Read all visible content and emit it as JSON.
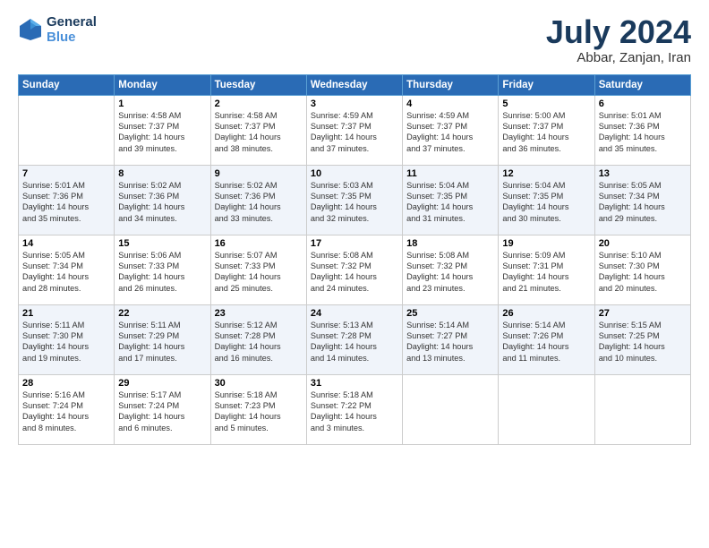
{
  "header": {
    "logo_line1": "General",
    "logo_line2": "Blue",
    "month": "July 2024",
    "location": "Abbar, Zanjan, Iran"
  },
  "weekdays": [
    "Sunday",
    "Monday",
    "Tuesday",
    "Wednesday",
    "Thursday",
    "Friday",
    "Saturday"
  ],
  "weeks": [
    [
      {
        "day": "",
        "sunrise": "",
        "sunset": "",
        "daylight": ""
      },
      {
        "day": "1",
        "sunrise": "Sunrise: 4:58 AM",
        "sunset": "Sunset: 7:37 PM",
        "daylight": "Daylight: 14 hours",
        "extra": "and 39 minutes."
      },
      {
        "day": "2",
        "sunrise": "Sunrise: 4:58 AM",
        "sunset": "Sunset: 7:37 PM",
        "daylight": "Daylight: 14 hours",
        "extra": "and 38 minutes."
      },
      {
        "day": "3",
        "sunrise": "Sunrise: 4:59 AM",
        "sunset": "Sunset: 7:37 PM",
        "daylight": "Daylight: 14 hours",
        "extra": "and 37 minutes."
      },
      {
        "day": "4",
        "sunrise": "Sunrise: 4:59 AM",
        "sunset": "Sunset: 7:37 PM",
        "daylight": "Daylight: 14 hours",
        "extra": "and 37 minutes."
      },
      {
        "day": "5",
        "sunrise": "Sunrise: 5:00 AM",
        "sunset": "Sunset: 7:37 PM",
        "daylight": "Daylight: 14 hours",
        "extra": "and 36 minutes."
      },
      {
        "day": "6",
        "sunrise": "Sunrise: 5:01 AM",
        "sunset": "Sunset: 7:36 PM",
        "daylight": "Daylight: 14 hours",
        "extra": "and 35 minutes."
      }
    ],
    [
      {
        "day": "7",
        "sunrise": "Sunrise: 5:01 AM",
        "sunset": "Sunset: 7:36 PM",
        "daylight": "Daylight: 14 hours",
        "extra": "and 35 minutes."
      },
      {
        "day": "8",
        "sunrise": "Sunrise: 5:02 AM",
        "sunset": "Sunset: 7:36 PM",
        "daylight": "Daylight: 14 hours",
        "extra": "and 34 minutes."
      },
      {
        "day": "9",
        "sunrise": "Sunrise: 5:02 AM",
        "sunset": "Sunset: 7:36 PM",
        "daylight": "Daylight: 14 hours",
        "extra": "and 33 minutes."
      },
      {
        "day": "10",
        "sunrise": "Sunrise: 5:03 AM",
        "sunset": "Sunset: 7:35 PM",
        "daylight": "Daylight: 14 hours",
        "extra": "and 32 minutes."
      },
      {
        "day": "11",
        "sunrise": "Sunrise: 5:04 AM",
        "sunset": "Sunset: 7:35 PM",
        "daylight": "Daylight: 14 hours",
        "extra": "and 31 minutes."
      },
      {
        "day": "12",
        "sunrise": "Sunrise: 5:04 AM",
        "sunset": "Sunset: 7:35 PM",
        "daylight": "Daylight: 14 hours",
        "extra": "and 30 minutes."
      },
      {
        "day": "13",
        "sunrise": "Sunrise: 5:05 AM",
        "sunset": "Sunset: 7:34 PM",
        "daylight": "Daylight: 14 hours",
        "extra": "and 29 minutes."
      }
    ],
    [
      {
        "day": "14",
        "sunrise": "Sunrise: 5:05 AM",
        "sunset": "Sunset: 7:34 PM",
        "daylight": "Daylight: 14 hours",
        "extra": "and 28 minutes."
      },
      {
        "day": "15",
        "sunrise": "Sunrise: 5:06 AM",
        "sunset": "Sunset: 7:33 PM",
        "daylight": "Daylight: 14 hours",
        "extra": "and 26 minutes."
      },
      {
        "day": "16",
        "sunrise": "Sunrise: 5:07 AM",
        "sunset": "Sunset: 7:33 PM",
        "daylight": "Daylight: 14 hours",
        "extra": "and 25 minutes."
      },
      {
        "day": "17",
        "sunrise": "Sunrise: 5:08 AM",
        "sunset": "Sunset: 7:32 PM",
        "daylight": "Daylight: 14 hours",
        "extra": "and 24 minutes."
      },
      {
        "day": "18",
        "sunrise": "Sunrise: 5:08 AM",
        "sunset": "Sunset: 7:32 PM",
        "daylight": "Daylight: 14 hours",
        "extra": "and 23 minutes."
      },
      {
        "day": "19",
        "sunrise": "Sunrise: 5:09 AM",
        "sunset": "Sunset: 7:31 PM",
        "daylight": "Daylight: 14 hours",
        "extra": "and 21 minutes."
      },
      {
        "day": "20",
        "sunrise": "Sunrise: 5:10 AM",
        "sunset": "Sunset: 7:30 PM",
        "daylight": "Daylight: 14 hours",
        "extra": "and 20 minutes."
      }
    ],
    [
      {
        "day": "21",
        "sunrise": "Sunrise: 5:11 AM",
        "sunset": "Sunset: 7:30 PM",
        "daylight": "Daylight: 14 hours",
        "extra": "and 19 minutes."
      },
      {
        "day": "22",
        "sunrise": "Sunrise: 5:11 AM",
        "sunset": "Sunset: 7:29 PM",
        "daylight": "Daylight: 14 hours",
        "extra": "and 17 minutes."
      },
      {
        "day": "23",
        "sunrise": "Sunrise: 5:12 AM",
        "sunset": "Sunset: 7:28 PM",
        "daylight": "Daylight: 14 hours",
        "extra": "and 16 minutes."
      },
      {
        "day": "24",
        "sunrise": "Sunrise: 5:13 AM",
        "sunset": "Sunset: 7:28 PM",
        "daylight": "Daylight: 14 hours",
        "extra": "and 14 minutes."
      },
      {
        "day": "25",
        "sunrise": "Sunrise: 5:14 AM",
        "sunset": "Sunset: 7:27 PM",
        "daylight": "Daylight: 14 hours",
        "extra": "and 13 minutes."
      },
      {
        "day": "26",
        "sunrise": "Sunrise: 5:14 AM",
        "sunset": "Sunset: 7:26 PM",
        "daylight": "Daylight: 14 hours",
        "extra": "and 11 minutes."
      },
      {
        "day": "27",
        "sunrise": "Sunrise: 5:15 AM",
        "sunset": "Sunset: 7:25 PM",
        "daylight": "Daylight: 14 hours",
        "extra": "and 10 minutes."
      }
    ],
    [
      {
        "day": "28",
        "sunrise": "Sunrise: 5:16 AM",
        "sunset": "Sunset: 7:24 PM",
        "daylight": "Daylight: 14 hours",
        "extra": "and 8 minutes."
      },
      {
        "day": "29",
        "sunrise": "Sunrise: 5:17 AM",
        "sunset": "Sunset: 7:24 PM",
        "daylight": "Daylight: 14 hours",
        "extra": "and 6 minutes."
      },
      {
        "day": "30",
        "sunrise": "Sunrise: 5:18 AM",
        "sunset": "Sunset: 7:23 PM",
        "daylight": "Daylight: 14 hours",
        "extra": "and 5 minutes."
      },
      {
        "day": "31",
        "sunrise": "Sunrise: 5:18 AM",
        "sunset": "Sunset: 7:22 PM",
        "daylight": "Daylight: 14 hours",
        "extra": "and 3 minutes."
      },
      {
        "day": "",
        "sunrise": "",
        "sunset": "",
        "daylight": "",
        "extra": ""
      },
      {
        "day": "",
        "sunrise": "",
        "sunset": "",
        "daylight": "",
        "extra": ""
      },
      {
        "day": "",
        "sunrise": "",
        "sunset": "",
        "daylight": "",
        "extra": ""
      }
    ]
  ]
}
